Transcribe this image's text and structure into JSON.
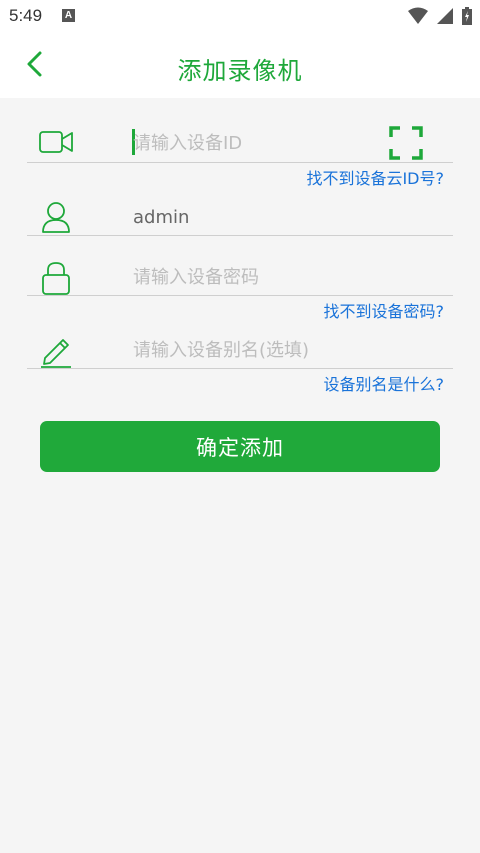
{
  "status_bar": {
    "time": "5:49",
    "notification_badge": "A",
    "icons": [
      "wifi-icon",
      "signal-icon",
      "battery-icon"
    ]
  },
  "app_bar": {
    "back_icon": "chevron-left-icon",
    "title": "添加录像机"
  },
  "form": {
    "device_id": {
      "icon": "video-camera-icon",
      "value": "",
      "placeholder": "请输入设备ID",
      "scan_icon": "qr-scan-icon",
      "help_link": "找不到设备云ID号?"
    },
    "username": {
      "icon": "user-icon",
      "value": "admin",
      "placeholder": ""
    },
    "password": {
      "icon": "lock-icon",
      "value": "",
      "placeholder": "请输入设备密码",
      "help_link": "找不到设备密码?"
    },
    "alias": {
      "icon": "pencil-icon",
      "value": "",
      "placeholder": "请输入设备别名(选填)",
      "help_link": "设备别名是什么?"
    }
  },
  "confirm_button": {
    "label": "确定添加"
  },
  "colors": {
    "accent": "#1ea83a",
    "link": "#1a73d9",
    "background": "#f5f5f5",
    "divider": "#cfcfcf"
  }
}
